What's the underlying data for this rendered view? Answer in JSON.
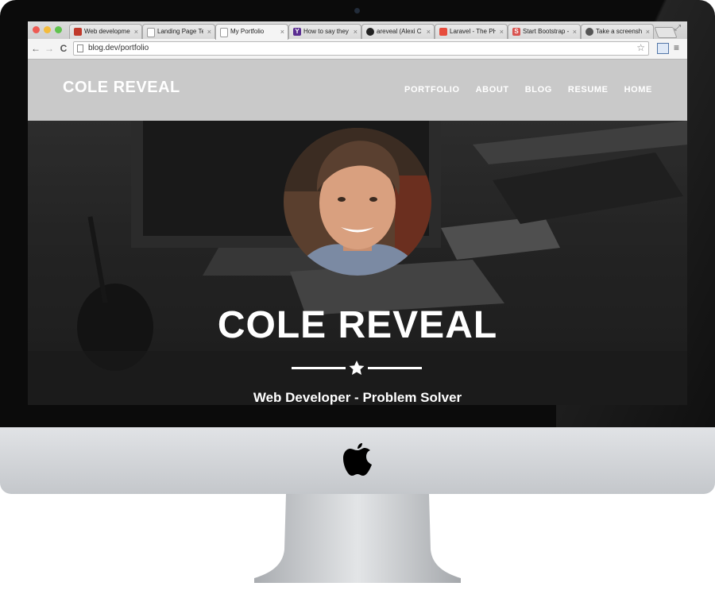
{
  "browser": {
    "tabs": [
      {
        "label": "Web development",
        "favicon": "tools-favicon",
        "color": "#c0392b"
      },
      {
        "label": "Landing Page Te",
        "favicon": "page-favicon",
        "color": "#ffffff"
      },
      {
        "label": "My Portfolio",
        "favicon": "page-favicon",
        "color": "#ffffff"
      },
      {
        "label": "How to say they",
        "favicon": "yahoo-favicon",
        "color": "#5a2d91"
      },
      {
        "label": "areveal (Alexi C",
        "favicon": "github-favicon",
        "color": "#222222"
      },
      {
        "label": "Laravel - The PH",
        "favicon": "laravel-favicon",
        "color": "#e74c3c"
      },
      {
        "label": "Start Bootstrap -",
        "favicon": "startbootstrap-favicon",
        "color": "#d9534f"
      },
      {
        "label": "Take a screensho",
        "favicon": "apple-favicon",
        "color": "#555555"
      }
    ],
    "active_tab": 2,
    "tab_close": "×",
    "url": "blog.dev/portfolio",
    "back": "←",
    "forward": "→",
    "reload": "C",
    "star": "☆",
    "menu": "≡",
    "expand": "⤢"
  },
  "site": {
    "brand": "COLE REVEAL",
    "nav": [
      "PORTFOLIO",
      "ABOUT",
      "BLOG",
      "RESUME",
      "HOME"
    ],
    "hero_name": "COLE REVEAL",
    "tagline": "Web Developer - Problem Solver",
    "divider_icon": "star-icon"
  },
  "colors": {
    "nav_bg": "#c9c9c9",
    "hero_bg": "#2f2f2f",
    "text": "#ffffff"
  }
}
